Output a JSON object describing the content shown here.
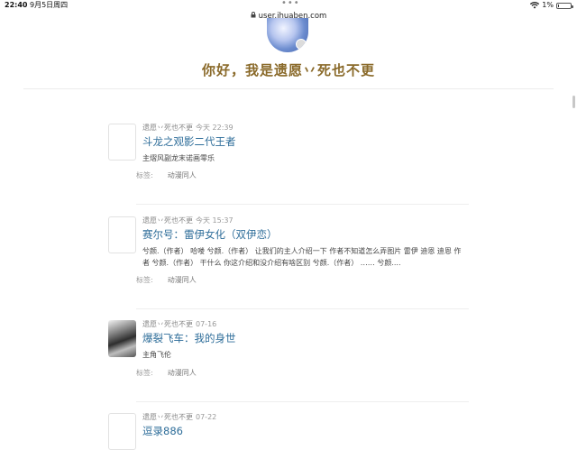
{
  "status_bar": {
    "time": "22:40",
    "date": "9月5日周四",
    "multitask": "•••",
    "wifi_icon": "wifi-icon",
    "battery_percent": "1%",
    "battery_level": 0.01
  },
  "browser": {
    "url": "user.ihuaben.com"
  },
  "profile": {
    "greeting": "你好，我是遗愿丷死也不更"
  },
  "stories": [
    {
      "author": "遗愿丷死也不更",
      "time": "今天 22:39",
      "title": "斗龙之观影二代王者",
      "description": "主熠风副龙末诺画零乐",
      "tags_label": "标签:",
      "tag": "动漫同人"
    },
    {
      "author": "遗愿丷死也不更",
      "time": "今天 15:37",
      "title": "赛尔号：雷伊女化（双伊恋）",
      "description": "兮颜.（作者） 哈喽 兮颜.（作者） 让我们的主人介绍一下 作者不知道怎么弄图片 雷伊 迪恩 迪恩 作者 兮颜.（作者） 干什么 你这介绍和没介绍有啥区别 兮颜.（作者） …… 兮颜....",
      "tags_label": "标签:",
      "tag": "动漫同人"
    },
    {
      "author": "遗愿丷死也不更",
      "time": "07-16",
      "title": "爆裂飞车：我的身世",
      "description": "主角飞伦",
      "tags_label": "标签:",
      "tag": "动漫同人"
    },
    {
      "author": "遗愿丷死也不更",
      "time": "07-22",
      "title": "逗录886"
    }
  ]
}
